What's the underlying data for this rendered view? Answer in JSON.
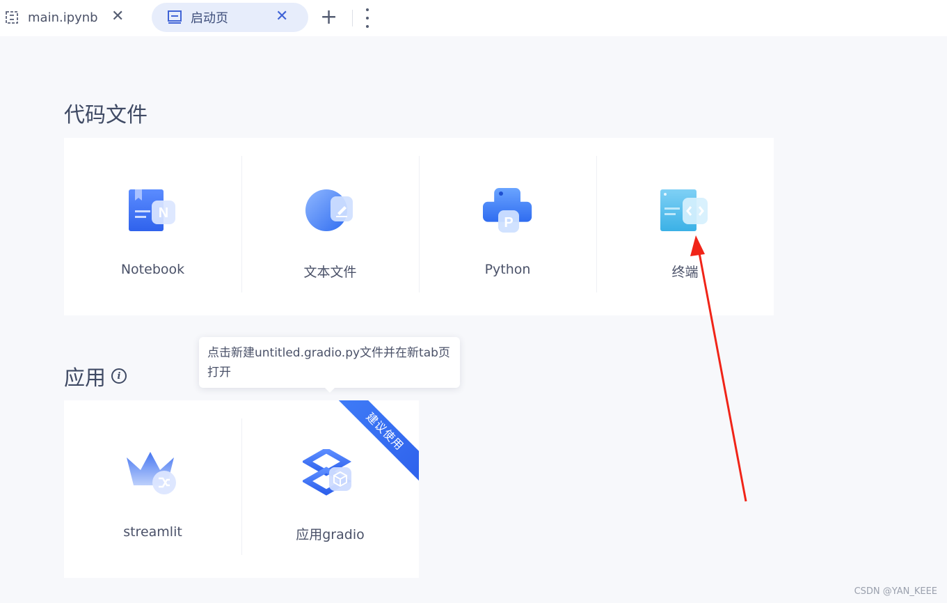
{
  "tabs": [
    {
      "label": "main.ipynb",
      "icon": "notebook-tab-icon",
      "active": false
    },
    {
      "label": "启动页",
      "icon": "launcher-tab-icon",
      "active": true
    }
  ],
  "sections": {
    "code": {
      "title": "代码文件",
      "cards": [
        {
          "label": "Notebook",
          "icon": "notebook-icon"
        },
        {
          "label": "文本文件",
          "icon": "text-file-icon"
        },
        {
          "label": "Python",
          "icon": "python-icon"
        },
        {
          "label": "终端",
          "icon": "terminal-icon"
        }
      ]
    },
    "apps": {
      "title": "应用",
      "cards": [
        {
          "label": "streamlit",
          "icon": "streamlit-icon"
        },
        {
          "label": "应用gradio",
          "icon": "gradio-icon",
          "badge": "建议使用"
        }
      ]
    }
  },
  "tooltip": {
    "text": "点击新建untitled.gradio.py文件并在新tab页打开"
  },
  "watermark": "CSDN @YAN_KEEE",
  "colors": {
    "accent": "#3f63d6",
    "ribbon": "#2f62ec",
    "annotation_arrow": "#f02418"
  }
}
